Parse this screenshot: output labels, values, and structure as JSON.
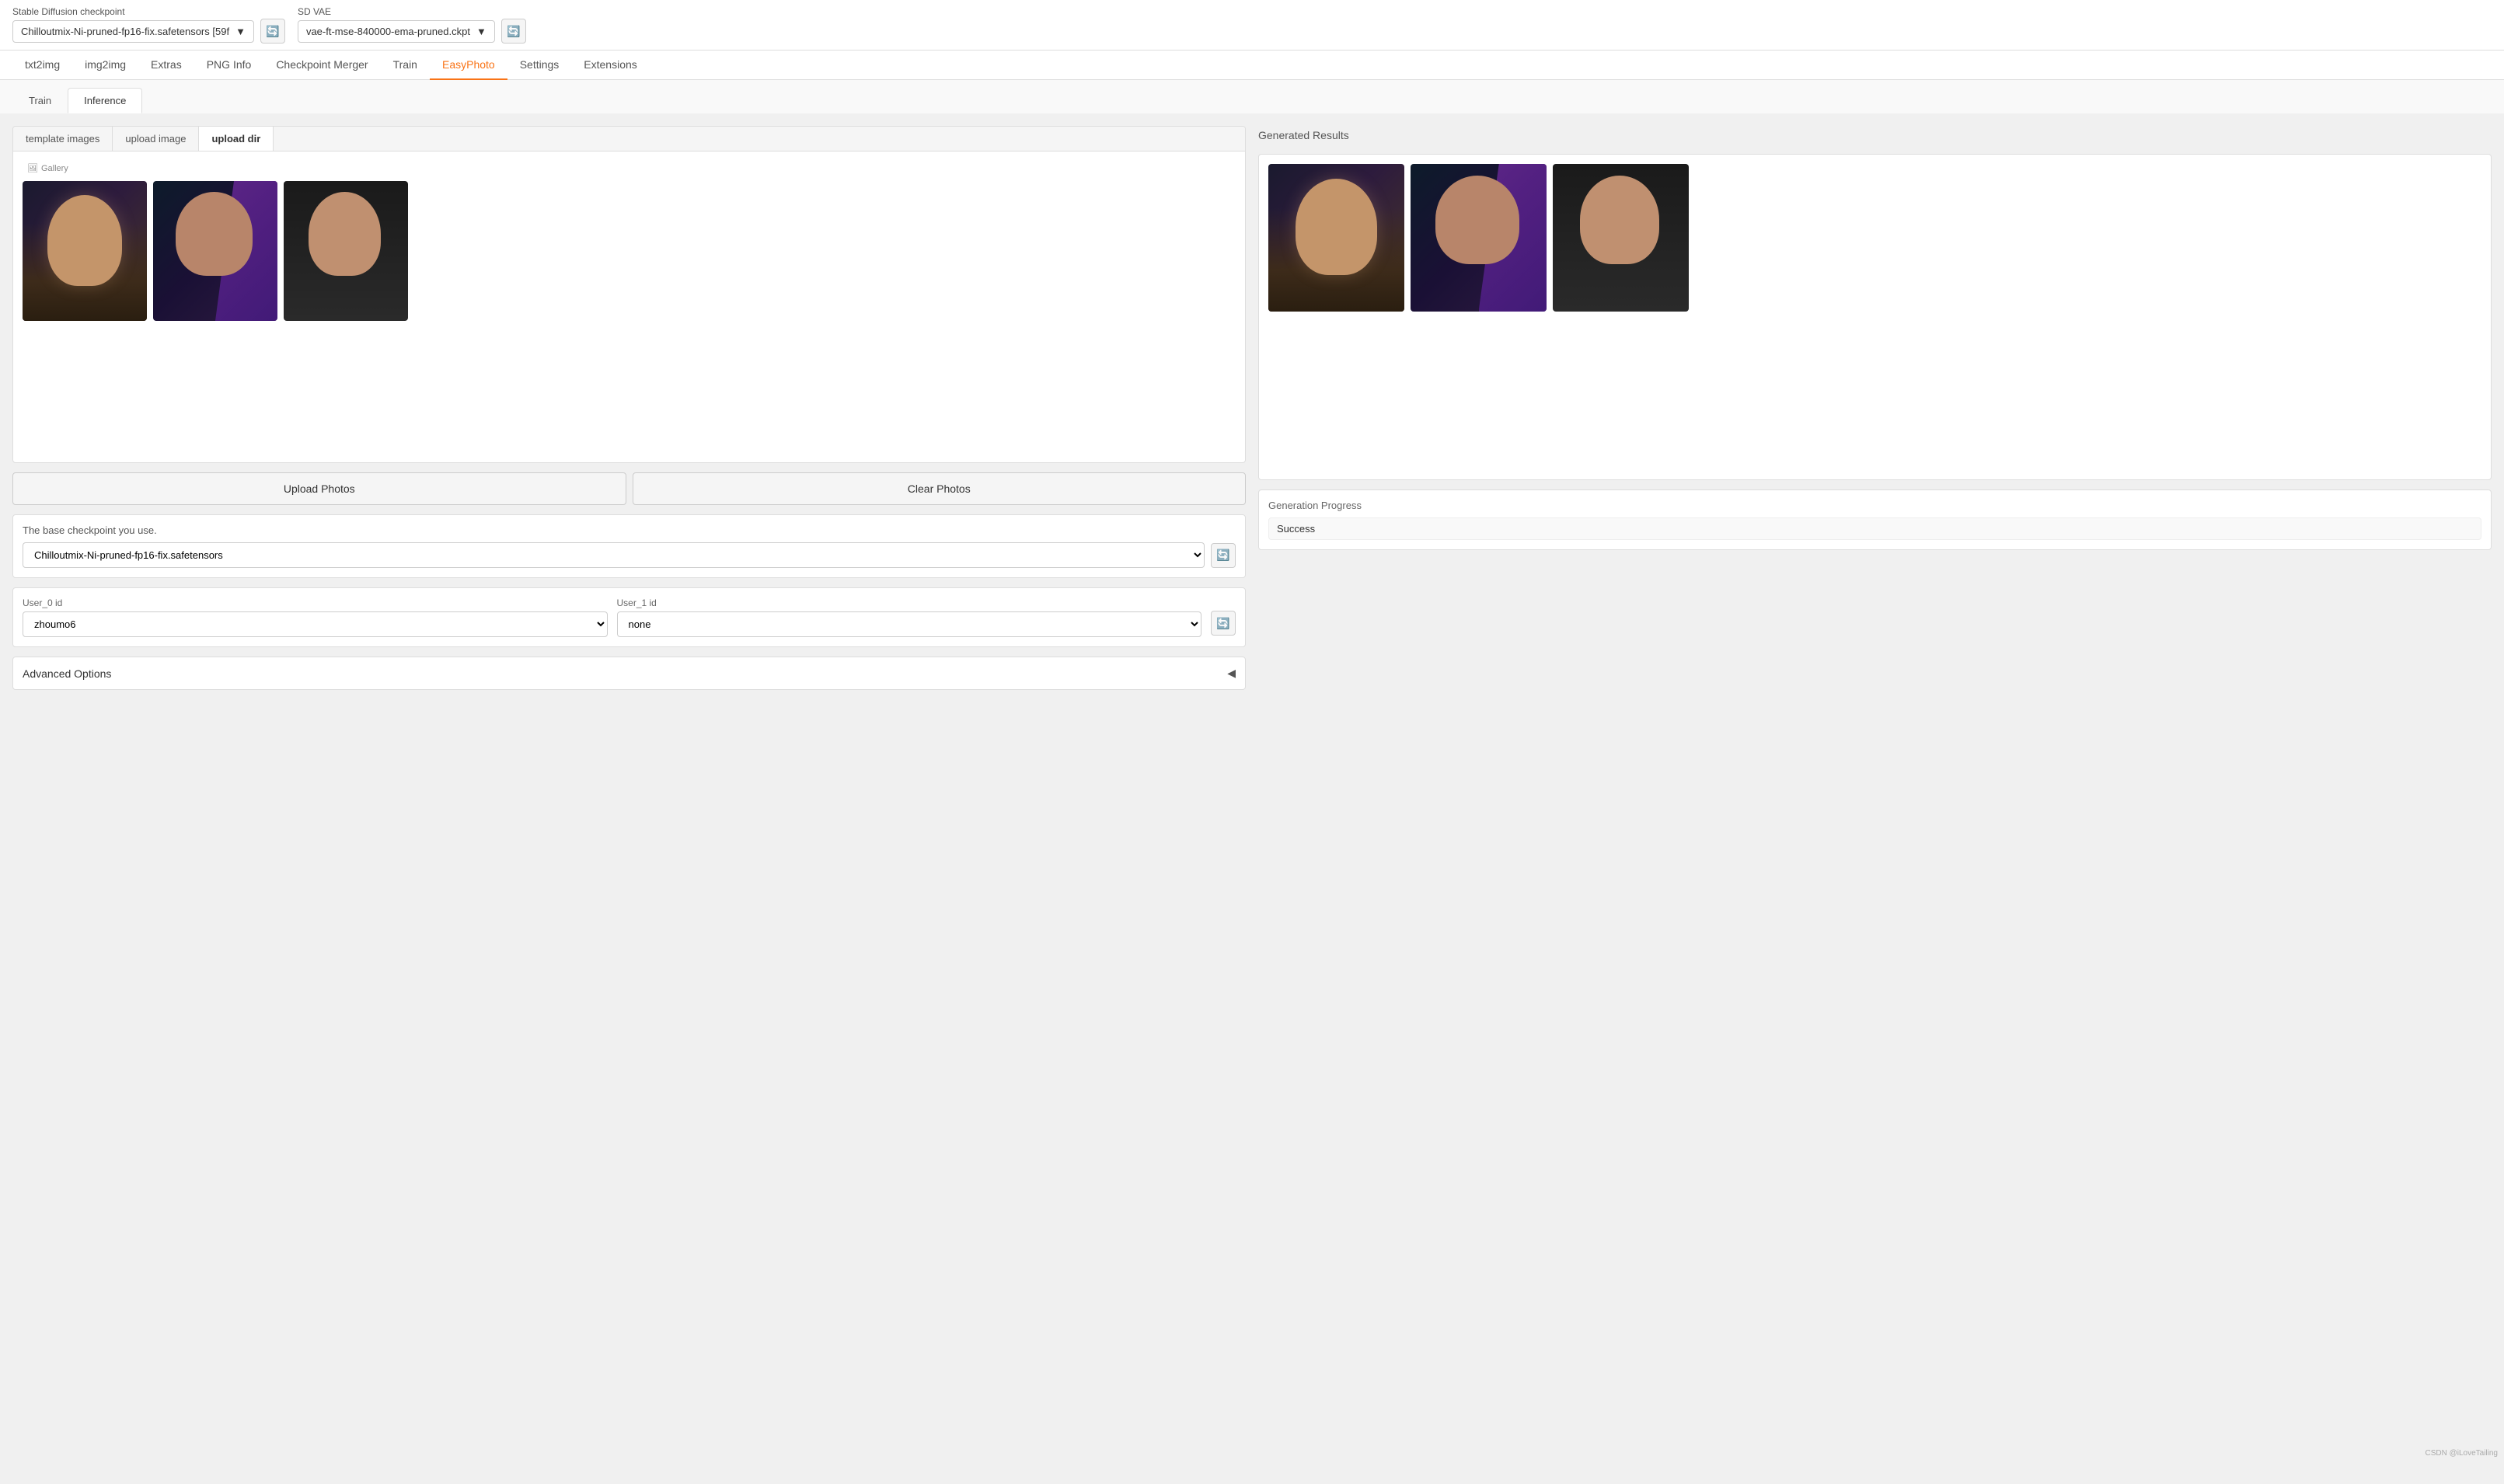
{
  "topbar": {
    "checkpoint_label": "Stable Diffusion checkpoint",
    "checkpoint_value": "Chilloutmix-Ni-pruned-fp16-fix.safetensors [59f",
    "vae_label": "SD VAE",
    "vae_value": "vae-ft-mse-840000-ema-pruned.ckpt"
  },
  "main_tabs": [
    {
      "id": "txt2img",
      "label": "txt2img",
      "active": false
    },
    {
      "id": "img2img",
      "label": "img2img",
      "active": false
    },
    {
      "id": "extras",
      "label": "Extras",
      "active": false
    },
    {
      "id": "png_info",
      "label": "PNG Info",
      "active": false
    },
    {
      "id": "checkpoint_merger",
      "label": "Checkpoint Merger",
      "active": false
    },
    {
      "id": "train",
      "label": "Train",
      "active": false
    },
    {
      "id": "easyphoto",
      "label": "EasyPhoto",
      "active": true
    },
    {
      "id": "settings",
      "label": "Settings",
      "active": false
    },
    {
      "id": "extensions",
      "label": "Extensions",
      "active": false
    }
  ],
  "sub_tabs": [
    {
      "id": "train",
      "label": "Train",
      "active": false
    },
    {
      "id": "inference",
      "label": "Inference",
      "active": true
    }
  ],
  "image_tabs": [
    {
      "id": "template_images",
      "label": "template images",
      "active": false
    },
    {
      "id": "upload_image",
      "label": "upload image",
      "active": false
    },
    {
      "id": "upload_dir",
      "label": "upload dir",
      "active": true
    }
  ],
  "gallery": {
    "label": "Gallery",
    "images": [
      {
        "id": "img1",
        "style": "portrait-1"
      },
      {
        "id": "img2",
        "style": "portrait-2"
      },
      {
        "id": "img3",
        "style": "portrait-3"
      }
    ]
  },
  "buttons": {
    "upload_photos": "Upload Photos",
    "clear_photos": "Clear Photos"
  },
  "checkpoint_section": {
    "label": "The base checkpoint you use.",
    "value": "Chilloutmix-Ni-pruned-fp16-fix.safetensors"
  },
  "user_ids": {
    "user0_label": "User_0 id",
    "user0_value": "zhoumo6",
    "user1_label": "User_1 id",
    "user1_value": "none"
  },
  "advanced": {
    "label": "Advanced Options"
  },
  "right_panel": {
    "generated_results_label": "Generated Results",
    "progress_label": "Generation Progress",
    "progress_value": "Success"
  },
  "watermark": "CSDN @iLoveTailing"
}
